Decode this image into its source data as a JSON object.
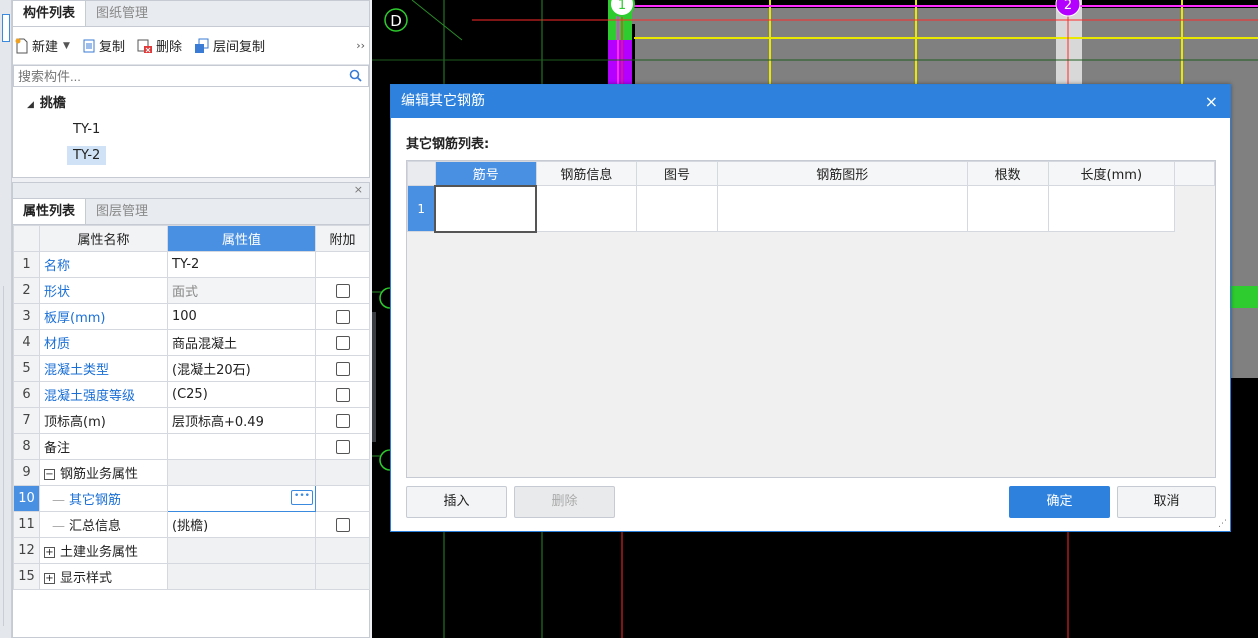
{
  "component_panel": {
    "tabs": [
      "构件列表",
      "图纸管理"
    ],
    "toolbar": {
      "new": "新建",
      "copy": "复制",
      "delete": "删除",
      "floor_copy": "层间复制",
      "more": "››"
    },
    "search_placeholder": "搜索构件...",
    "tree": {
      "root": "挑檐",
      "children": [
        "TY-1",
        "TY-2"
      ],
      "selected": "TY-2"
    }
  },
  "property_panel": {
    "close": "×",
    "tabs": [
      "属性列表",
      "图层管理"
    ],
    "headers": {
      "name": "属性名称",
      "value": "属性值",
      "extra": "附加"
    },
    "rows": [
      {
        "idx": "1",
        "name": "名称",
        "value": "TY-2"
      },
      {
        "idx": "2",
        "name": "形状",
        "value": "面式"
      },
      {
        "idx": "3",
        "name": "板厚(mm)",
        "value": "100"
      },
      {
        "idx": "4",
        "name": "材质",
        "value": "商品混凝土"
      },
      {
        "idx": "5",
        "name": "混凝土类型",
        "value": "(混凝土20石)"
      },
      {
        "idx": "6",
        "name": "混凝土强度等级",
        "value": "(C25)"
      },
      {
        "idx": "7",
        "name": "顶标高(m)",
        "value": "层顶标高+0.49"
      },
      {
        "idx": "8",
        "name": "备注",
        "value": ""
      },
      {
        "idx": "9",
        "name": "钢筋业务属性",
        "value": ""
      },
      {
        "idx": "10",
        "name": "其它钢筋",
        "value": ""
      },
      {
        "idx": "11",
        "name": "汇总信息",
        "value": "(挑檐)"
      },
      {
        "idx": "12",
        "name": "土建业务属性",
        "value": ""
      },
      {
        "idx": "15",
        "name": "显示样式",
        "value": ""
      }
    ]
  },
  "canvas": {
    "axis_labels": [
      "D",
      "1",
      "2"
    ]
  },
  "dialog": {
    "title": "编辑其它钢筋",
    "close": "×",
    "list_label": "其它钢筋列表:",
    "columns": [
      "筋号",
      "钢筋信息",
      "图号",
      "钢筋图形",
      "根数",
      "长度(mm)"
    ],
    "rows": [
      "1"
    ],
    "buttons": {
      "insert": "插入",
      "delete": "删除",
      "ok": "确定",
      "cancel": "取消"
    }
  },
  "colors": {
    "accent": "#2e82dd",
    "selection_blue": "#4a90e2",
    "cad_green": "#2ecc2e",
    "cad_purple": "#b300ff",
    "cad_yellow": "#e8e800",
    "cad_red": "#ff2a2a",
    "cad_magenta": "#ff2aff"
  }
}
